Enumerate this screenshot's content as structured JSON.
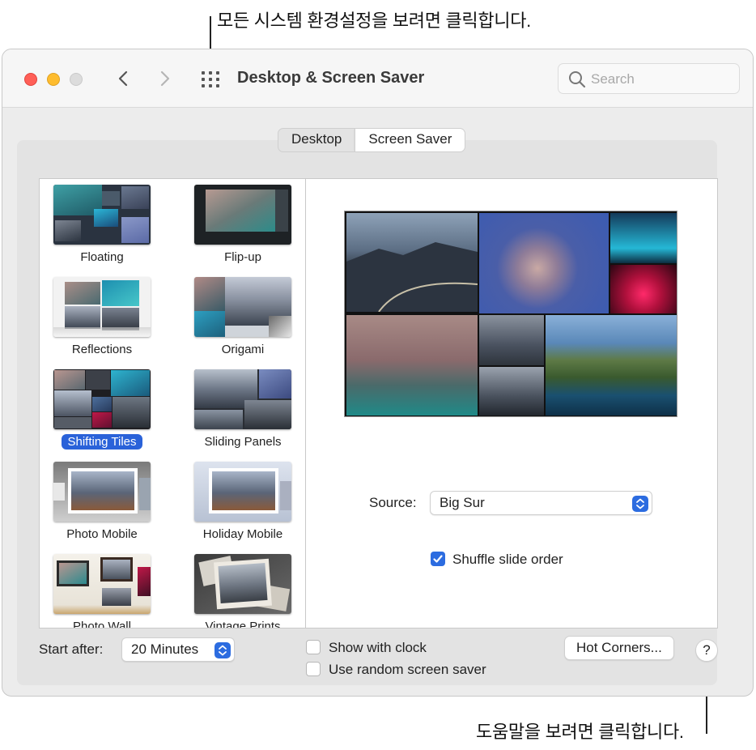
{
  "callouts": {
    "top": "모든 시스템 환경설정을 보려면 클릭합니다.",
    "bottom": "도움말을 보려면 클릭합니다."
  },
  "window": {
    "title": "Desktop & Screen Saver",
    "search_placeholder": "Search"
  },
  "tabs": [
    {
      "label": "Desktop",
      "selected": false
    },
    {
      "label": "Screen Saver",
      "selected": true
    }
  ],
  "screensavers": [
    {
      "label": "Floating",
      "selected": false
    },
    {
      "label": "Flip-up",
      "selected": false
    },
    {
      "label": "Reflections",
      "selected": false
    },
    {
      "label": "Origami",
      "selected": false
    },
    {
      "label": "Shifting Tiles",
      "selected": true
    },
    {
      "label": "Sliding Panels",
      "selected": false
    },
    {
      "label": "Photo Mobile",
      "selected": false
    },
    {
      "label": "Holiday Mobile",
      "selected": false
    },
    {
      "label": "Photo Wall",
      "selected": false
    },
    {
      "label": "Vintage Prints",
      "selected": false
    }
  ],
  "options": {
    "source_label": "Source:",
    "source_value": "Big Sur",
    "shuffle_label": "Shuffle slide order",
    "shuffle_checked": true
  },
  "bottom_bar": {
    "start_after_label": "Start after:",
    "start_after_value": "20 Minutes",
    "show_clock_label": "Show with clock",
    "show_clock_checked": false,
    "random_label": "Use random screen saver",
    "random_checked": false,
    "hot_corners_label": "Hot Corners...",
    "help_label": "?"
  },
  "colors": {
    "accent": "#2c6ce0",
    "selection": "#2a62d9",
    "close": "#ff5f57",
    "minimize": "#febc2e"
  }
}
